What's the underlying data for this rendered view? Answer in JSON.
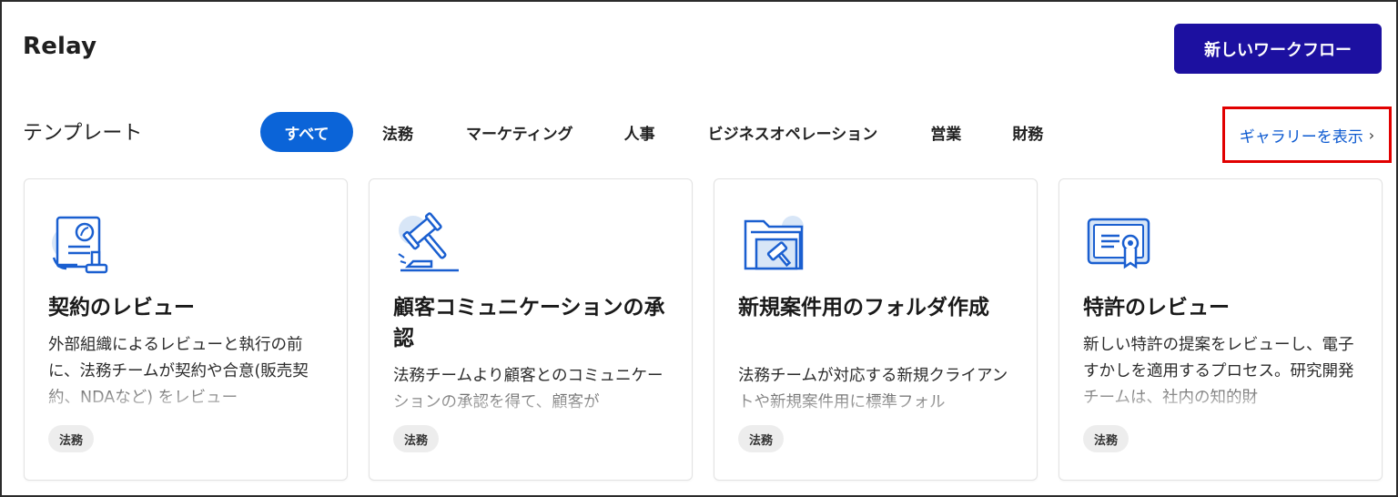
{
  "header": {
    "app_title": "Relay",
    "new_workflow_label": "新しいワークフロー"
  },
  "templates": {
    "section_title": "テンプレート",
    "tabs": [
      {
        "label": "すべて",
        "active": true
      },
      {
        "label": "法務",
        "active": false
      },
      {
        "label": "マーケティング",
        "active": false
      },
      {
        "label": "人事",
        "active": false
      },
      {
        "label": "ビジネスオペレーション",
        "active": false
      },
      {
        "label": "営業",
        "active": false
      },
      {
        "label": "財務",
        "active": false
      }
    ],
    "gallery_link_label": "ギャラリーを表示",
    "cards": [
      {
        "icon": "contract-document-icon",
        "title": "契約のレビュー",
        "description": "外部組織によるレビューと執行の前に、法務チームが契約や合意(販売契約、NDAなど) をレビュー",
        "tag": "法務"
      },
      {
        "icon": "gavel-icon",
        "title": "顧客コミュニケーションの承認",
        "description": "法務チームより顧客とのコミュニケーションの承認を得て、顧客が",
        "tag": "法務"
      },
      {
        "icon": "legal-folder-icon",
        "title": "新規案件用のフォルダ作成",
        "description": "法務チームが対応する新規クライアントや新規案件用に標準フォル",
        "tag": "法務"
      },
      {
        "icon": "certificate-icon",
        "title": "特許のレビュー",
        "description": "新しい特許の提案をレビューし、電子すかしを適用するプロセス。研究開発チームは、社内の知的財",
        "tag": "法務"
      }
    ]
  },
  "colors": {
    "primary_button": "#1c10a0",
    "active_tab": "#0b64d8",
    "link": "#0a58d0",
    "highlight_border": "#e10000",
    "icon_blue": "#1a5fd0",
    "icon_light": "#d8e6f7"
  }
}
